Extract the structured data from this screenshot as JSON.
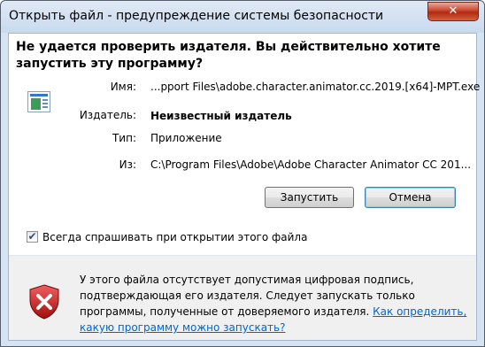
{
  "window": {
    "title": "Открыть файл - предупреждение системы безопасности",
    "close_label": "✕"
  },
  "header": {
    "line1": "Не удается проверить издателя.  Вы действительно хотите",
    "line2": "запустить эту программу?"
  },
  "fields": {
    "name_label": "Имя:",
    "name_value": "...pport Files\\adobe.character.animator.cc.2019.[x64]-MPT.exe",
    "publisher_label": "Издатель:",
    "publisher_value": "Неизвестный издатель",
    "type_label": "Тип:",
    "type_value": "Приложение",
    "from_label": "Из:",
    "from_value": "C:\\Program Files\\Adobe\\Adobe Character Animator CC 201..."
  },
  "buttons": {
    "run": "Запустить",
    "cancel": "Отмена"
  },
  "checkbox": {
    "label": "Всегда спрашивать при открытии этого файла",
    "checked": true,
    "mark": "✔"
  },
  "warning": {
    "text": "У этого файла отсутствует допустимая цифровая подпись, подтверждающая его издателя. Следует запускать только программы, полученные от доверяемого издателя.",
    "link": "Как определить, какую программу можно запускать?"
  },
  "icons": {
    "app": "app-icon",
    "shield": "security-shield-error-icon"
  }
}
